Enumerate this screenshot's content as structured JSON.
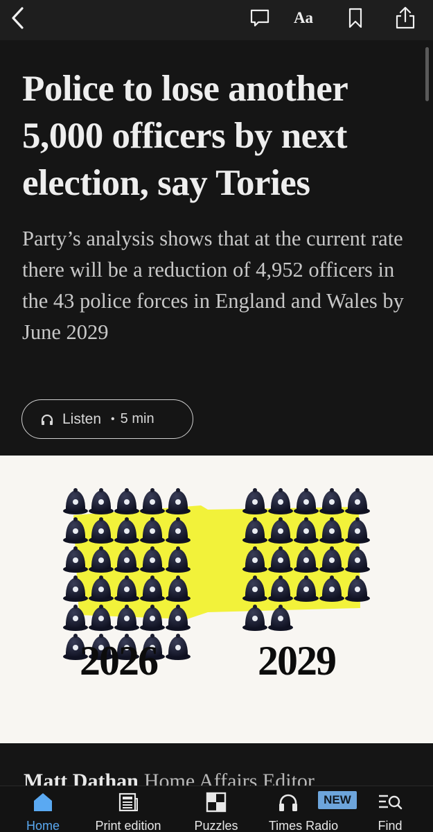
{
  "toolbar": {
    "back_icon": "chevron-left-icon",
    "comment_icon": "comment-icon",
    "text_size_label": "Aa",
    "bookmark_icon": "bookmark-icon",
    "share_icon": "share-icon"
  },
  "article": {
    "headline": "Police to lose another 5,000 officers by next election, say Tories",
    "standfirst": "Party’s analysis shows that at the current rate there will be a reduction of 4,952 officers in the 43 police forces in England and Wales by June 2029",
    "listen": {
      "label": "Listen",
      "separator": "•",
      "duration": "5 min"
    },
    "illustration": {
      "years": [
        "2026",
        "2029"
      ],
      "helmets_2026": 30,
      "helmets_2029": 22,
      "colors": {
        "background": "#f8f6f2",
        "highlight": "#f2f23a",
        "helmet": "#121524"
      }
    },
    "byline": {
      "name": "Matt Dathan",
      "role": "Home Affairs Editor"
    }
  },
  "tabs": [
    {
      "label": "Home",
      "icon": "home-icon",
      "active": true
    },
    {
      "label": "Print edition",
      "icon": "newspaper-icon",
      "active": false
    },
    {
      "label": "Puzzles",
      "icon": "puzzle-grid-icon",
      "active": false
    },
    {
      "label": "Times Radio",
      "icon": "headphones-icon",
      "active": false,
      "badge": "NEW"
    },
    {
      "label": "Find",
      "icon": "search-menu-icon",
      "active": false
    }
  ],
  "colors": {
    "background": "#151515",
    "accent": "#5aa9f2",
    "badge": "#6da5dc"
  }
}
